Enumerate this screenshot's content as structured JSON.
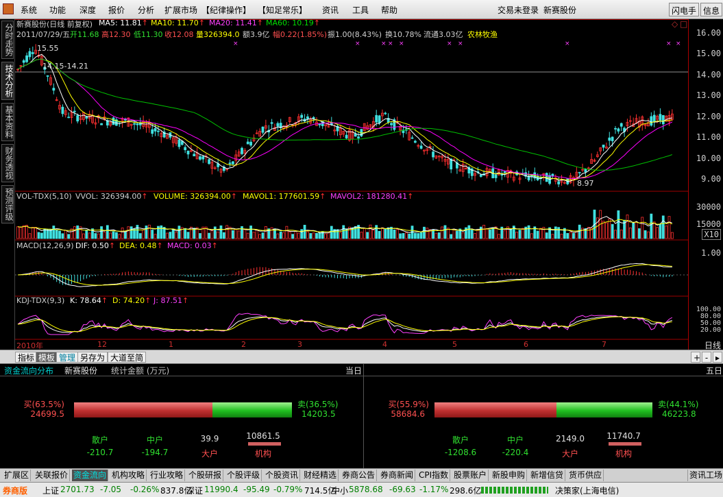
{
  "menubar": {
    "items": [
      "系统",
      "功能",
      "深度",
      "报价",
      "分析",
      "扩展市场",
      "【纪律操作】",
      "【知足常乐】",
      "资讯",
      "工具",
      "帮助"
    ],
    "status": "交易未登录",
    "stock": "新赛股份",
    "flash_button": "闪电手",
    "info_button": "信息"
  },
  "left_tabs": [
    "分时走势",
    "技术分析",
    "基本资料",
    "财务透视",
    "预测评级"
  ],
  "price_header": {
    "name": "新赛股份(日线 前复权)",
    "ma5": "MA5: 11.81",
    "ma10": "MA10: 11.70",
    "ma20": "MA20: 11.41",
    "ma60": "MA60: 10.19",
    "date": "2011/07/29/五",
    "open": "开11.68",
    "high": "高12.30",
    "low": "低11.30",
    "close": "收12.08",
    "volume": "量326394.0",
    "amount": "额3.9亿",
    "change": "幅0.22(1.85%)",
    "amplitude": "振1.00(8.43%)",
    "turnover": "换10.78%",
    "float_cap": "流通3.03亿",
    "industry": "农林牧渔"
  },
  "price_annotations": {
    "high_label": "15.55",
    "range_label": "14.15-14.21",
    "low_label": "8.97"
  },
  "price_axis": [
    "16.00",
    "15.00",
    "14.00",
    "13.00",
    "12.00",
    "11.00",
    "10.00",
    "9.00"
  ],
  "vol_header": {
    "name": "VOL-TDX(5,10)",
    "vvol": "VVOL: 326394.00",
    "volume": "VOLUME: 326394.00",
    "mavol1": "MAVOL1: 177601.59",
    "mavol2": "MAVOL2: 181280.41"
  },
  "vol_axis": [
    "30000",
    "15000"
  ],
  "vol_unit": "X10",
  "macd_header": {
    "name": "MACD(12,26,9)",
    "dif": "DIF: 0.50",
    "dea": "DEA: 0.48",
    "macd": "MACD: 0.03"
  },
  "macd_axis": [
    "1.00"
  ],
  "kdj_header": {
    "name": "KDJ-TDX(9,3)",
    "k": "K: 78.64",
    "d": "D: 74.20",
    "j": "J: 87.51"
  },
  "kdj_axis": [
    "100.00",
    "80.00",
    "50.00",
    "20.00"
  ],
  "time_axis": [
    "2010年",
    "12",
    "1",
    "2",
    "3",
    "4",
    "5",
    "6",
    "7"
  ],
  "period_label": "日线",
  "sub_tabs": [
    "指标",
    "模板",
    "管理",
    "另存为",
    "大道至简"
  ],
  "flow": {
    "title": "资金流向分布",
    "stock": "新赛股份",
    "unit": "统计金额 (万元)",
    "today_label": "当日",
    "five_label": "五日",
    "today": {
      "buy_pct": "买(63.5%)",
      "buy_val": "24699.5",
      "sell_pct": "卖(36.5%)",
      "sell_val": "14203.5",
      "buy_ratio": 0.635,
      "retail": "散户",
      "mid": "中户",
      "big_val": "39.9",
      "inst_val": "10861.5",
      "retail_val": "-210.7",
      "mid_val": "-194.7",
      "big": "大户",
      "inst": "机构"
    },
    "five": {
      "buy_pct": "买(55.9%)",
      "buy_val": "58684.6",
      "sell_pct": "卖(44.1%)",
      "sell_val": "46223.8",
      "buy_ratio": 0.559,
      "retail": "散户",
      "mid": "中户",
      "big_val": "2149.0",
      "inst_val": "11740.7",
      "retail_val": "-1208.6",
      "mid_val": "-220.4",
      "big": "大户",
      "inst": "机构"
    }
  },
  "bottom_tabs": [
    "扩展区",
    "关联报价",
    "资金流向",
    "机构攻略",
    "行业攻略",
    "个股研报",
    "个股评级",
    "个股资讯",
    "财经精选",
    "券商公告",
    "券商新闻",
    "CPI指数",
    "股票账户",
    "新股申购",
    "新增信贷",
    "货币供应"
  ],
  "bottom_right": "资讯工场",
  "statusbar": {
    "broker": "券商版",
    "sh_label": "上证",
    "sh_val": "2701.73",
    "sh_chg": "-7.05",
    "sh_pct": "-0.26%",
    "sh_amt": "837.8亿",
    "sz_label": "深证",
    "sz_val": "11990.4",
    "sz_chg": "-95.49",
    "sz_pct": "-0.79%",
    "sz_amt": "714.5亿",
    "zx_label": "中小",
    "zx_val": "5878.68",
    "zx_chg": "-69.63",
    "zx_pct": "-1.17%",
    "zx_amt": "298.6亿",
    "server": "决策家(上海电信)"
  },
  "colors": {
    "up": "#ff3030",
    "down": "#40e0e0",
    "ma5": "#ffffff",
    "ma10": "#ffff00",
    "ma20": "#ff00ff",
    "ma60": "#00c000"
  }
}
